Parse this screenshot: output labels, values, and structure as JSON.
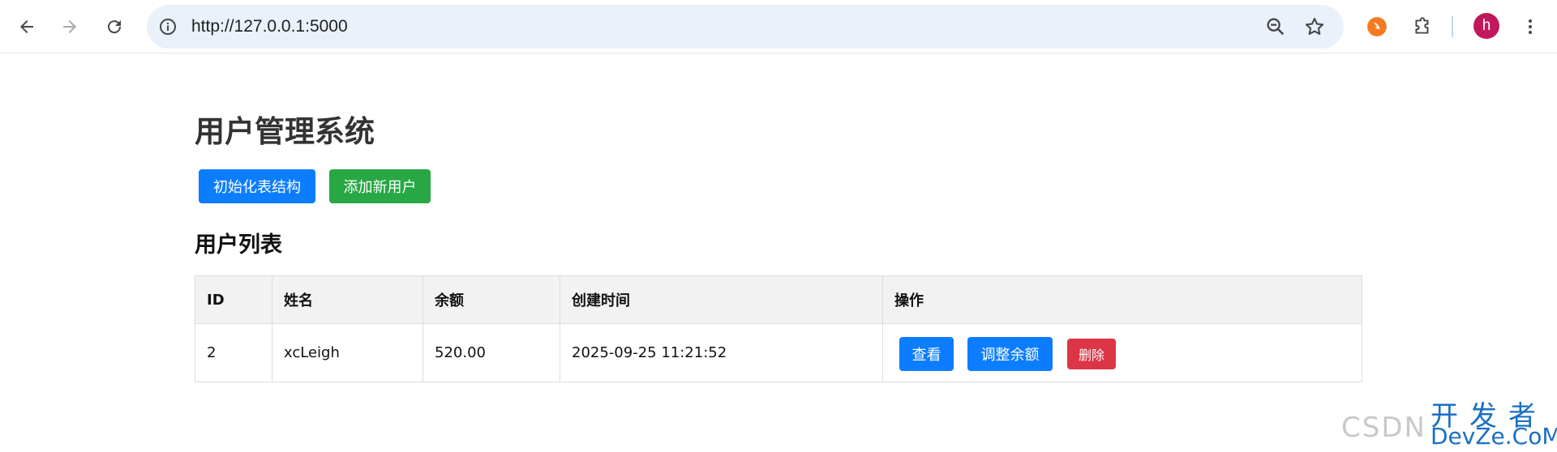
{
  "browser": {
    "url": "http://127.0.0.1:5000",
    "profile_initial": "h",
    "icons": {
      "back": "arrow-left-icon",
      "forward": "arrow-right-icon",
      "reload": "reload-icon",
      "site_info": "info-icon",
      "zoom": "zoom-out-icon",
      "bookmark": "star-icon",
      "extension_orange": "extension-icon",
      "extensions": "puzzle-icon",
      "menu": "kebab-menu-icon"
    }
  },
  "page": {
    "title": "用户管理系统",
    "buttons": {
      "init_schema": "初始化表结构",
      "add_user": "添加新用户"
    },
    "list_title": "用户列表",
    "table": {
      "headers": [
        "ID",
        "姓名",
        "余额",
        "创建时间",
        "操作"
      ],
      "rows": [
        {
          "id": "2",
          "name": "xcLeigh",
          "balance": "520.00",
          "created_at": "2025-09-25 11:21:52",
          "actions": {
            "view": "查看",
            "adjust_balance": "调整余额",
            "delete": "删除"
          }
        }
      ]
    }
  },
  "watermark": {
    "csdn": "CSDN",
    "kfz": "开发者",
    "devze": "DevZe.CoM"
  },
  "colors": {
    "primary": "#0d7dff",
    "success": "#28a745",
    "danger": "#dc3545",
    "omnibox_bg": "#eaf1fb",
    "avatar_bg": "#c2185b"
  }
}
